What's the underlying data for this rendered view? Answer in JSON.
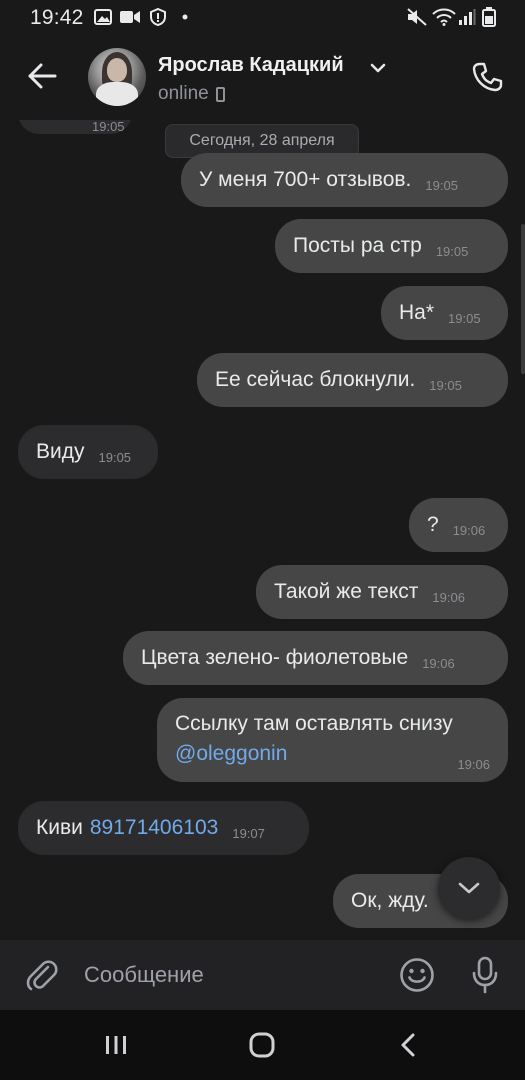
{
  "status_bar": {
    "time": "19:42",
    "icons": [
      "image-icon",
      "video-icon",
      "shield-icon",
      "dot-icon",
      "mute-icon",
      "wifi-icon",
      "signal-icon",
      "battery-icon"
    ]
  },
  "header": {
    "contact_name": "Ярослав Кадацкий",
    "status": "online",
    "back_icon": "arrow-left-icon",
    "call_icon": "phone-icon"
  },
  "chat": {
    "date_separator": "Сегодня, 28 апреля",
    "partial_top_time": "19:05",
    "messages": [
      {
        "dir": "out",
        "text": "У меня 700+ отзывов.",
        "time": "19:05"
      },
      {
        "dir": "out",
        "text": "Посты ра стр",
        "time": "19:05"
      },
      {
        "dir": "out",
        "text": "На*",
        "time": "19:05"
      },
      {
        "dir": "out",
        "text": "Ее сейчас блокнули.",
        "time": "19:05"
      },
      {
        "dir": "in",
        "text": "Виду",
        "time": "19:05"
      },
      {
        "dir": "out",
        "text": "?",
        "time": "19:06"
      },
      {
        "dir": "out",
        "text": "Такой же текст",
        "time": "19:06"
      },
      {
        "dir": "out",
        "text": "Цвета зелено- фиолетовые",
        "time": "19:06"
      },
      {
        "dir": "out",
        "text": "Ссылку там оставлять снизу",
        "link": "@oleggonin",
        "time": "19:06"
      },
      {
        "dir": "in",
        "text": "Киви",
        "link": "89171406103",
        "time": "19:07"
      },
      {
        "dir": "out",
        "text": "Ок, жду."
      }
    ]
  },
  "composer": {
    "placeholder": "Сообщение",
    "attach_icon": "paperclip-icon",
    "emoji_icon": "smile-icon",
    "mic_icon": "microphone-icon"
  },
  "navbar": {
    "buttons": [
      "recents-icon",
      "home-icon",
      "back-icon"
    ]
  },
  "colors": {
    "background": "#19191a",
    "outgoing_bubble": "#464646",
    "incoming_bubble": "#2c2c2e",
    "link": "#71aaeb",
    "secondary_text": "#8a8d91"
  }
}
